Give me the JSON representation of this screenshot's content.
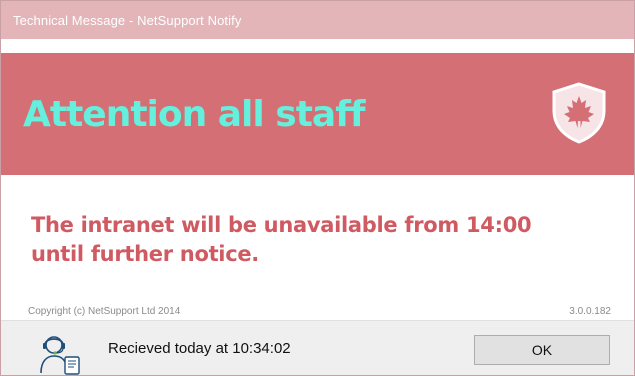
{
  "window": {
    "title": "Technical Message - NetSupport Notify"
  },
  "banner": {
    "title": "Attention all staff",
    "icon": "shield-maple-leaf-icon",
    "background_color": "#d46f76",
    "title_color": "#64f0dc"
  },
  "message": {
    "text": "The intranet will be unavailable from 14:00 until further notice.",
    "color": "#d05a62"
  },
  "meta": {
    "copyright": "Copyright (c) NetSupport Ltd 2014",
    "version": "3.0.0.182"
  },
  "footer": {
    "icon": "support-agent-icon",
    "received_text": "Recieved today at 10:34:02",
    "ok_label": "OK"
  }
}
